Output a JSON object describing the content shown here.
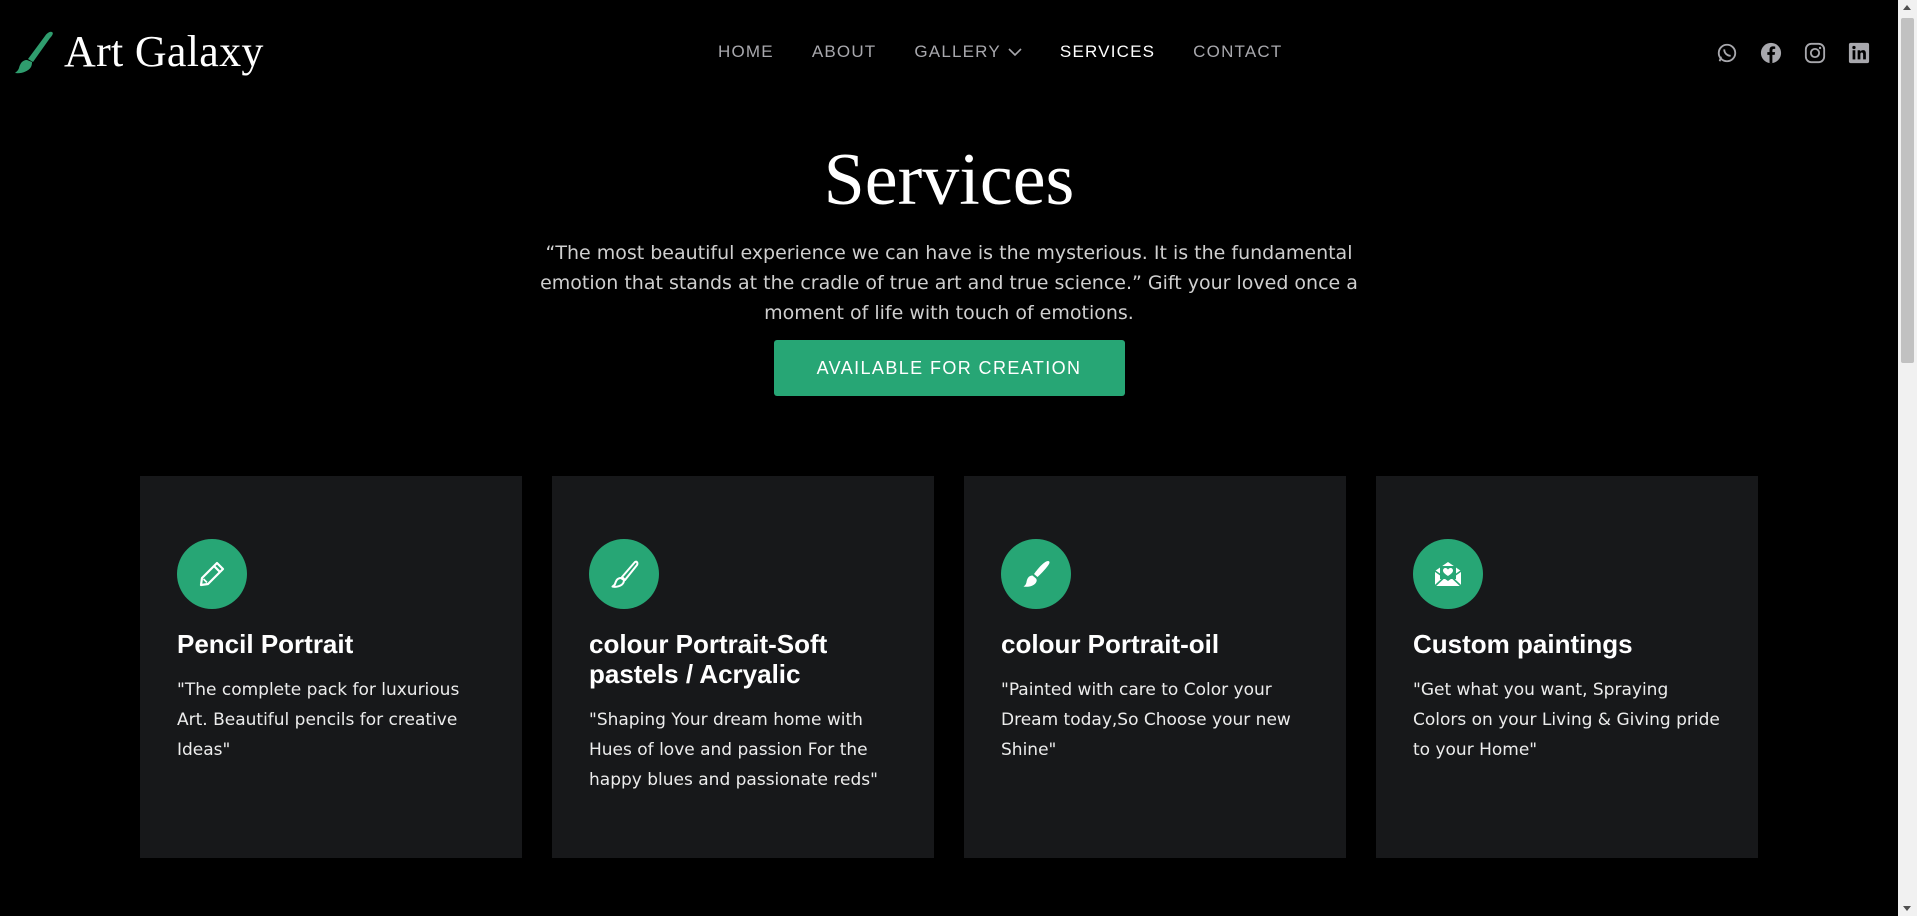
{
  "brand": {
    "name": "Art Galaxy",
    "icon": "paintbrush-icon",
    "accent": "#27a675"
  },
  "nav": {
    "items": [
      {
        "label": "HOME",
        "active": false
      },
      {
        "label": "ABOUT",
        "active": false
      },
      {
        "label": "GALLERY",
        "active": false,
        "dropdown": true
      },
      {
        "label": "SERVICES",
        "active": true
      },
      {
        "label": "CONTACT",
        "active": false
      }
    ]
  },
  "social": [
    "whatsapp-icon",
    "facebook-icon",
    "instagram-icon",
    "linkedin-icon"
  ],
  "hero": {
    "title": "Services",
    "text": "“The most beautiful experience we can have is the mysterious. It is the fundamental emotion that stands at the cradle of true art and true science.” Gift your loved once a moment of life with touch of emotions.",
    "cta_label": "AVAILABLE FOR CREATION"
  },
  "cards": [
    {
      "icon": "pencil-icon",
      "title": "Pencil Portrait",
      "text": "\"The complete pack for luxurious Art. Beautiful pencils for creative Ideas\""
    },
    {
      "icon": "brush-icon",
      "title": "colour Portrait-Soft pastels / Acryalic",
      "text": "\"Shaping Your dream home with Hues of love and passion For the happy blues and passionate reds\""
    },
    {
      "icon": "paint-brush-icon",
      "title": "colour Portrait-oil",
      "text": "\"Painted with care to Color your Dream today,So Choose your new Shine\""
    },
    {
      "icon": "envelope-heart-icon",
      "title": "Custom paintings",
      "text": "\"Get what you want, Spraying Colors on your Living & Giving pride to your Home\""
    }
  ],
  "colors": {
    "background": "#000000",
    "card": "#17181a",
    "accent": "#27a675",
    "nav_inactive": "#a8a8ad"
  }
}
